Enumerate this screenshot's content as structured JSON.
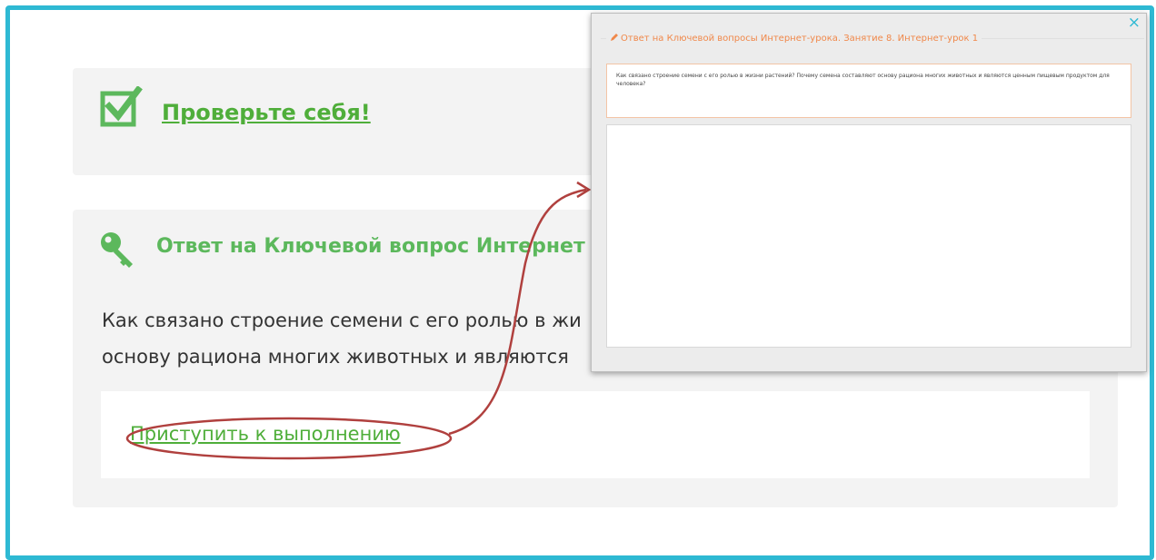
{
  "check": {
    "link_label": "Проверьте себя!"
  },
  "key_question": {
    "title": "Ответ на Ключевой вопрос Интернет",
    "lines": [
      "Как связано строение семени с его ролью в жи",
      "основу рациона многих животных и являются"
    ],
    "start_label": "Приступить к выполнению"
  },
  "popup": {
    "close_glyph": "×",
    "legend": "Ответ на Ключевой вопросы Интернет-урока. Занятие 8. Интернет-урок 1",
    "question_text": "Как связано строение семени с его ролью в жизни растений? Почему семена составляют основу рациона многих животных и являются ценным пищевым продуктом для человека?",
    "answer_value": ""
  },
  "colors": {
    "frame_border": "#2eb9d3",
    "link_green": "#4fae3a",
    "title_green": "#5cb85c",
    "legend_orange": "#f0884a",
    "annotation_red": "#b0403e"
  }
}
